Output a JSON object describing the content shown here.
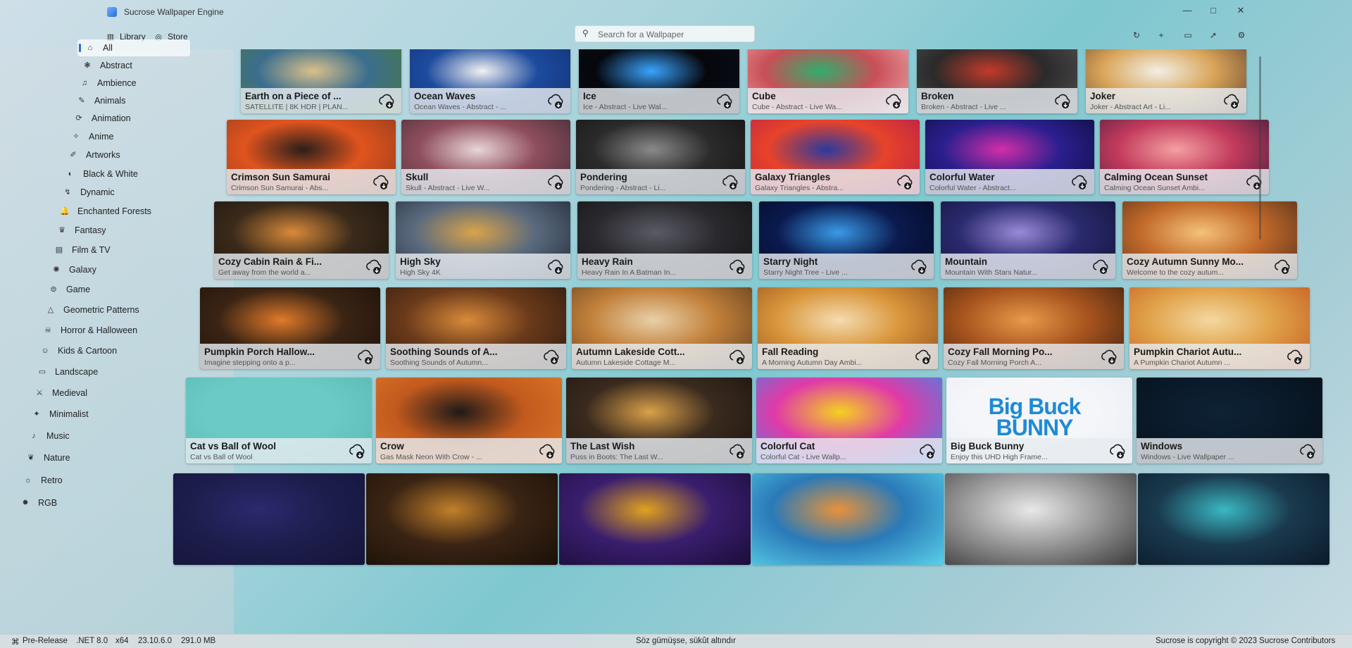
{
  "app": {
    "title": "Sucrose Wallpaper Engine"
  },
  "window_controls": {
    "minimize": "—",
    "maximize": "□",
    "close": "✕"
  },
  "nav": {
    "tabs": [
      {
        "label": "Library",
        "icon": "library-icon"
      },
      {
        "label": "Store",
        "icon": "store-icon"
      }
    ],
    "search_placeholder": "Search for a Wallpaper",
    "toolbar_icons": [
      "refresh-icon",
      "add-icon",
      "display-icon",
      "pin-icon",
      "settings-icon"
    ]
  },
  "sidebar": {
    "items": [
      {
        "label": "All",
        "icon": "home-icon",
        "active": true
      },
      {
        "label": "Abstract",
        "icon": "abstract-icon"
      },
      {
        "label": "Ambience",
        "icon": "headphones-icon"
      },
      {
        "label": "Animals",
        "icon": "animals-icon"
      },
      {
        "label": "Animation",
        "icon": "animation-icon"
      },
      {
        "label": "Anime",
        "icon": "anime-icon"
      },
      {
        "label": "Artworks",
        "icon": "artworks-icon"
      },
      {
        "label": "Black & White",
        "icon": "contrast-icon"
      },
      {
        "label": "Dynamic",
        "icon": "dynamic-icon"
      },
      {
        "label": "Enchanted Forests",
        "icon": "bell-icon"
      },
      {
        "label": "Fantasy",
        "icon": "crown-icon"
      },
      {
        "label": "Film & TV",
        "icon": "film-icon"
      },
      {
        "label": "Galaxy",
        "icon": "galaxy-icon"
      },
      {
        "label": "Game",
        "icon": "gamepad-icon"
      },
      {
        "label": "Geometric Patterns",
        "icon": "triangle-icon"
      },
      {
        "label": "Horror & Halloween",
        "icon": "horror-icon"
      },
      {
        "label": "Kids & Cartoon",
        "icon": "kids-icon"
      },
      {
        "label": "Landscape",
        "icon": "landscape-icon"
      },
      {
        "label": "Medieval",
        "icon": "medieval-icon"
      },
      {
        "label": "Minimalist",
        "icon": "minimalist-icon"
      },
      {
        "label": "Music",
        "icon": "music-icon"
      },
      {
        "label": "Nature",
        "icon": "nature-icon"
      },
      {
        "label": "Retro",
        "icon": "retro-icon"
      },
      {
        "label": "RGB",
        "icon": "rgb-icon"
      }
    ]
  },
  "wallpapers": [
    {
      "title": "Earth on a Piece of ...",
      "subtitle": "SATELLITE | 8K HDR | PLAN...",
      "colors": [
        "#3b6e8e",
        "#d9c08a",
        "#4a7a3a"
      ]
    },
    {
      "title": "Ocean Waves",
      "subtitle": "Ocean Waves - Abstract - ...",
      "colors": [
        "#1d4b9e",
        "#f2f2f2",
        "#0f2f6e"
      ]
    },
    {
      "title": "Ice",
      "subtitle": "Ice - Abstract - Live Wal...",
      "colors": [
        "#05070c",
        "#3aa4ff",
        "#0a0f1c"
      ]
    },
    {
      "title": "Cube",
      "subtitle": "Cube - Abstract - Live Wa...",
      "colors": [
        "#c94f57",
        "#2fae6b",
        "#f0b7bc"
      ]
    },
    {
      "title": "Broken",
      "subtitle": "Broken - Abstract - Live ...",
      "colors": [
        "#2a2a2a",
        "#c43a2a",
        "#555555"
      ]
    },
    {
      "title": "Joker",
      "subtitle": "Joker - Abstract Art - Li...",
      "colors": [
        "#d9a55a",
        "#f2efe5",
        "#5a3a2a"
      ]
    },
    {
      "title": "Crimson Sun Samurai",
      "subtitle": "Crimson Sun Samurai - Abs...",
      "colors": [
        "#e0541e",
        "#2a1f1a",
        "#8e3a1c"
      ]
    },
    {
      "title": "Skull",
      "subtitle": "Skull - Abstract - Live W...",
      "colors": [
        "#8f4e5c",
        "#e8d6d8",
        "#3b2a35"
      ]
    },
    {
      "title": "Pondering",
      "subtitle": "Pondering - Abstract - Li...",
      "colors": [
        "#2b2b2b",
        "#8a8a8a",
        "#111111"
      ]
    },
    {
      "title": "Galaxy Triangles",
      "subtitle": "Galaxy Triangles - Abstra...",
      "colors": [
        "#e8432a",
        "#2b3a9e",
        "#b21c4a"
      ]
    },
    {
      "title": "Colorful Water",
      "subtitle": "Colorful Water - Abstract...",
      "colors": [
        "#2a1f8e",
        "#d42ea8",
        "#0e0c3a"
      ]
    },
    {
      "title": "Calming Ocean Sunset",
      "subtitle": "Calming Ocean Sunset Ambi...",
      "colors": [
        "#c23a5c",
        "#f4a0a0",
        "#3a1c3a"
      ]
    },
    {
      "title": "Cozy Cabin Rain & Fi...",
      "subtitle": "Get away from the world a...",
      "colors": [
        "#3a2a1a",
        "#d98a3a",
        "#1a1410"
      ]
    },
    {
      "title": "High Sky",
      "subtitle": "High Sky 4K",
      "colors": [
        "#5a6a7e",
        "#d9a34a",
        "#1e2633"
      ]
    },
    {
      "title": "Heavy Rain",
      "subtitle": "Heavy Rain In A Batman In...",
      "colors": [
        "#2a2a2e",
        "#5a5a66",
        "#121214"
      ]
    },
    {
      "title": "Starry Night",
      "subtitle": "Starry Night Tree - Live ...",
      "colors": [
        "#0a1a4e",
        "#3a9ae8",
        "#05081e"
      ]
    },
    {
      "title": "Mountain",
      "subtitle": "Mountain With Stars Natur...",
      "colors": [
        "#2a2a6e",
        "#9a8ad8",
        "#111133"
      ]
    },
    {
      "title": "Cozy Autumn Sunny Mo...",
      "subtitle": "Welcome to the cozy autum...",
      "colors": [
        "#c26a2a",
        "#f4c27a",
        "#4a2a1a"
      ]
    },
    {
      "title": "Pumpkin Porch Hallow...",
      "subtitle": "Imagine stepping onto a p...",
      "colors": [
        "#3a2414",
        "#e07a2a",
        "#1a1008"
      ]
    },
    {
      "title": "Soothing Sounds of A...",
      "subtitle": "Soothing Sounds of Autumn...",
      "colors": [
        "#6a3a1a",
        "#d98a3a",
        "#2a1a0e"
      ]
    },
    {
      "title": "Autumn Lakeside Cott...",
      "subtitle": "Autumn Lakeside Cottage M...",
      "colors": [
        "#c2803a",
        "#e8d0a8",
        "#5a3a1e"
      ]
    },
    {
      "title": "Fall Reading",
      "subtitle": "A Morning Autumn Day Ambi...",
      "colors": [
        "#d9953a",
        "#f4dcb0",
        "#8a4a1e"
      ]
    },
    {
      "title": "Cozy Fall Morning Po...",
      "subtitle": "Cozy Fall Morning Porch A...",
      "colors": [
        "#a8541e",
        "#e89a4a",
        "#3a1e0e"
      ]
    },
    {
      "title": "Pumpkin Chariot Autu...",
      "subtitle": "A Pumpkin Chariot Autumn ...",
      "colors": [
        "#e0a24a",
        "#f4d8a0",
        "#c2541e"
      ]
    },
    {
      "title": "Cat vs Ball of Wool",
      "subtitle": "Cat vs Ball of Wool",
      "colors": [
        "#6ccac4",
        "#6ccac4",
        "#5ab8b2"
      ]
    },
    {
      "title": "Crow",
      "subtitle": "Gas Mask Neon With Crow - ...",
      "colors": [
        "#c25a1e",
        "#1e1a18",
        "#e07a2a"
      ]
    },
    {
      "title": "The Last Wish",
      "subtitle": "Puss in Boots: The Last W...",
      "colors": [
        "#3a2a1e",
        "#d9a04a",
        "#1a1410"
      ]
    },
    {
      "title": "Colorful Cat",
      "subtitle": "Colorful Cat - Live Wallp...",
      "colors": [
        "#e03aa8",
        "#f4d21e",
        "#3a8ae8"
      ]
    },
    {
      "title": "Big Buck Bunny",
      "subtitle": "Enjoy this UHD High Frame...",
      "colors": [
        "#f4f6fa",
        "#f4f6fa",
        "#e8ecf2"
      ],
      "logo": "Big Buck BUNNY"
    },
    {
      "title": "Windows",
      "subtitle": "Windows - Live Wallpaper ...",
      "colors": [
        "#0a1a2a",
        "#0e2236",
        "#061018"
      ]
    },
    {
      "title": "",
      "subtitle": "",
      "colors": [
        "#1e1e4e",
        "#2a2a6e",
        "#14143a"
      ]
    },
    {
      "title": "",
      "subtitle": "",
      "colors": [
        "#3a2414",
        "#c2802a",
        "#1a1008"
      ]
    },
    {
      "title": "",
      "subtitle": "",
      "colors": [
        "#3a1e6e",
        "#e0a21e",
        "#1a0e3a"
      ]
    },
    {
      "title": "",
      "subtitle": "",
      "colors": [
        "#2a7ab8",
        "#e8923a",
        "#5ad0e8"
      ]
    },
    {
      "title": "",
      "subtitle": "",
      "colors": [
        "#9a9a9a",
        "#e8e8e8",
        "#3a3a3a"
      ]
    },
    {
      "title": "",
      "subtitle": "",
      "colors": [
        "#1a3a4e",
        "#3ab8c2",
        "#0a1a2a"
      ]
    }
  ],
  "statusbar": {
    "channel": "Pre-Release",
    "framework": ".NET 8.0",
    "arch": "x64",
    "version": "23.10.6.0",
    "memory": "291.0 MB",
    "quote": "Söz gümüşse, sükût altındır",
    "copyright": "Sucrose is copyright © 2023 Sucrose Contributors"
  }
}
